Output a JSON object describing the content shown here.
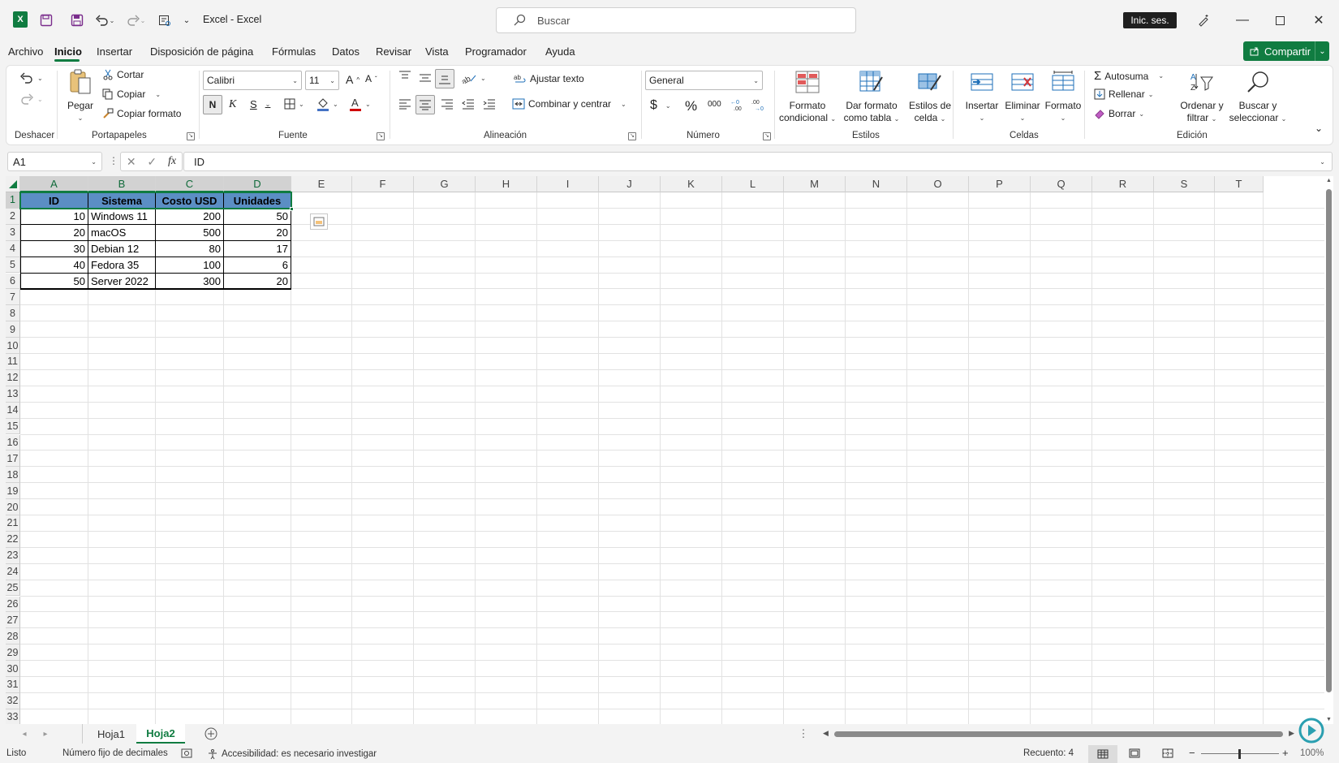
{
  "app": {
    "title": "Excel  -  Excel",
    "search_placeholder": "Buscar",
    "signin": "Inic. ses."
  },
  "menu": {
    "tabs": [
      "Archivo",
      "Inicio",
      "Insertar",
      "Disposición de página",
      "Fórmulas",
      "Datos",
      "Revisar",
      "Vista",
      "Programador",
      "Ayuda"
    ],
    "share": "Compartir"
  },
  "ribbon": {
    "deshacer": {
      "group": "Deshacer"
    },
    "portapapeles": {
      "group": "Portapapeles",
      "pegar": "Pegar",
      "cortar": "Cortar",
      "copiar": "Copiar",
      "copiar_formato": "Copiar formato"
    },
    "fuente": {
      "group": "Fuente",
      "font": "Calibri",
      "size": "11",
      "bold": "N",
      "italic": "K",
      "underline": "S"
    },
    "alineacion": {
      "group": "Alineación",
      "wrap": "Ajustar texto",
      "merge": "Combinar y centrar"
    },
    "numero": {
      "group": "Número",
      "format": "General",
      "currency": "$",
      "percent": "%",
      "thousands": "000"
    },
    "estilos": {
      "group": "Estilos",
      "cond1": "Formato",
      "cond2": "condicional",
      "table1": "Dar formato",
      "table2": "como tabla",
      "cell1": "Estilos de",
      "cell2": "celda"
    },
    "celdas": {
      "group": "Celdas",
      "insertar": "Insertar",
      "eliminar": "Eliminar",
      "formato": "Formato"
    },
    "edicion": {
      "group": "Edición",
      "autosuma": "Autosuma",
      "rellenar": "Rellenar",
      "borrar": "Borrar",
      "ordenar1": "Ordenar y",
      "ordenar2": "filtrar",
      "buscar1": "Buscar y",
      "buscar2": "seleccionar"
    }
  },
  "formula_bar": {
    "name_box": "A1",
    "fx": "fx",
    "content": "ID"
  },
  "grid": {
    "columns": [
      "A",
      "B",
      "C",
      "D",
      "E",
      "F",
      "G",
      "H",
      "I",
      "J",
      "K",
      "L",
      "M",
      "N",
      "O",
      "P",
      "Q",
      "R",
      "S",
      "T"
    ],
    "rows": [
      "1",
      "2",
      "3",
      "4",
      "5",
      "6",
      "7",
      "8",
      "9",
      "10",
      "11",
      "12",
      "13",
      "14",
      "15",
      "16",
      "17",
      "18",
      "19",
      "20",
      "21",
      "22",
      "23",
      "24",
      "25",
      "26",
      "27",
      "28",
      "29",
      "30",
      "31",
      "32",
      "33"
    ],
    "headers": [
      "ID",
      "Sistema",
      "Costo USD",
      "Unidades"
    ],
    "data": [
      [
        "10",
        "Windows 11",
        "200",
        "50"
      ],
      [
        "20",
        "macOS",
        "500",
        "20"
      ],
      [
        "30",
        "Debian 12",
        "80",
        "17"
      ],
      [
        "40",
        "Fedora 35",
        "100",
        "6"
      ],
      [
        "50",
        "Server 2022",
        "300",
        "20"
      ]
    ]
  },
  "sheets": {
    "tabs": [
      "Hoja1",
      "Hoja2"
    ],
    "active": "Hoja2"
  },
  "status": {
    "ready": "Listo",
    "fixed_decimal": "Número fijo de decimales",
    "accessibility": "Accesibilidad: es necesario investigar",
    "count": "Recuento: 4",
    "zoom": "100%"
  },
  "colors": {
    "accent": "#107c41",
    "header_fill": "#5b8ec4"
  }
}
